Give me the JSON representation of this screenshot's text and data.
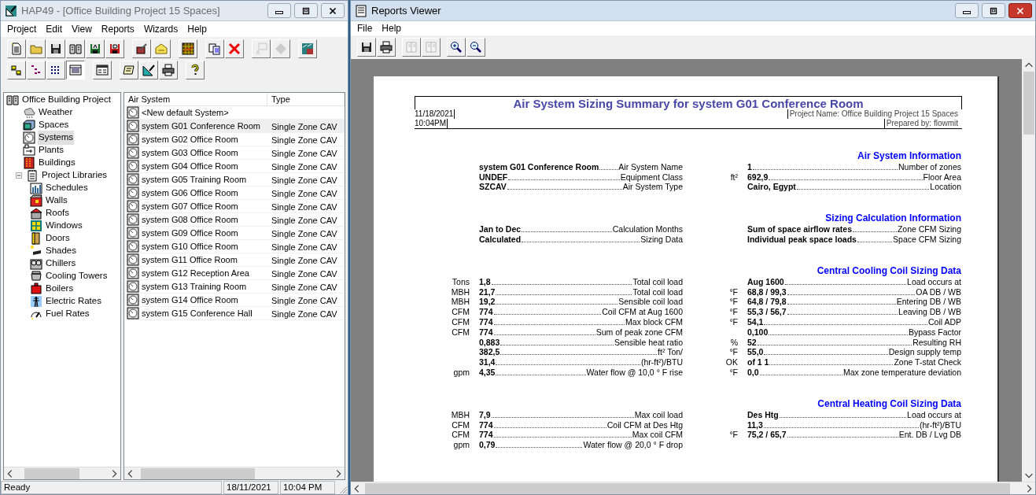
{
  "hap_window": {
    "title": "HAP49 - [Office Building Project 15 Spaces]",
    "active": false,
    "menu": [
      "Project",
      "Edit",
      "View",
      "Reports",
      "Wizards",
      "Help"
    ],
    "toolbar_rows": [
      [
        [
          {
            "disabled": false
          },
          {
            "disabled": false
          },
          {
            "disabled": false
          },
          {
            "disabled": false
          },
          {
            "disabled": false
          },
          {
            "disabled": false
          }
        ],
        [
          {
            "disabled": false
          },
          {
            "disabled": false
          }
        ],
        [
          {
            "disabled": false
          }
        ],
        [
          {
            "disabled": false
          },
          {
            "disabled": false
          }
        ],
        [
          {
            "disabled": true
          },
          {
            "disabled": true
          }
        ],
        [
          {
            "disabled": false
          }
        ]
      ],
      [
        [
          {
            "disabled": false,
            "selected": false
          },
          {
            "disabled": false,
            "selected": false
          },
          {
            "disabled": false,
            "selected": false
          },
          {
            "disabled": false,
            "selected": true
          }
        ],
        [
          {
            "disabled": false
          }
        ],
        [
          {
            "disabled": false
          },
          {
            "disabled": false
          },
          {
            "disabled": false
          }
        ],
        [
          {
            "disabled": false
          }
        ]
      ]
    ],
    "tree": [
      {
        "label": "Office Building Project",
        "selected": false,
        "children": [
          {
            "label": "Weather",
            "selected": false
          },
          {
            "label": "Spaces",
            "selected": false
          },
          {
            "label": "Systems",
            "selected": true
          },
          {
            "label": "Plants",
            "selected": false
          },
          {
            "label": "Buildings",
            "selected": false
          },
          {
            "label": "Project Libraries",
            "selected": false,
            "expanded": true,
            "children": [
              {
                "label": "Schedules",
                "selected": false
              },
              {
                "label": "Walls",
                "selected": false
              },
              {
                "label": "Roofs",
                "selected": false
              },
              {
                "label": "Windows",
                "selected": false
              },
              {
                "label": "Doors",
                "selected": false
              },
              {
                "label": "Shades",
                "selected": false
              },
              {
                "label": "Chillers",
                "selected": false
              },
              {
                "label": "Cooling Towers",
                "selected": false
              },
              {
                "label": "Boilers",
                "selected": false
              },
              {
                "label": "Electric Rates",
                "selected": false
              },
              {
                "label": "Fuel Rates",
                "selected": false
              }
            ]
          }
        ]
      }
    ],
    "list": {
      "columns": [
        "Air System",
        "Type"
      ],
      "rows": [
        {
          "name": "<New default System>",
          "selected": false
        },
        {
          "name": "system G01 Conference Room",
          "type": "Single Zone CAV",
          "selected": true
        },
        {
          "name": "system G02 Office Room",
          "type": "Single Zone CAV",
          "selected": false
        },
        {
          "name": "system G03 Office Room",
          "type": "Single Zone CAV",
          "selected": false
        },
        {
          "name": "system G04 Office Room",
          "type": "Single Zone CAV",
          "selected": false
        },
        {
          "name": "system G05 Training Room",
          "type": "Single Zone CAV",
          "selected": false
        },
        {
          "name": "system G06 Office Room",
          "type": "Single Zone CAV",
          "selected": false
        },
        {
          "name": "system G07 Office Room",
          "type": "Single Zone CAV",
          "selected": false
        },
        {
          "name": "system G08 Office Room",
          "type": "Single Zone CAV",
          "selected": false
        },
        {
          "name": "system G09 Office Room",
          "type": "Single Zone CAV",
          "selected": false
        },
        {
          "name": "system G10 Office Room",
          "type": "Single Zone CAV",
          "selected": false
        },
        {
          "name": "system G11 Office Room",
          "type": "Single Zone CAV",
          "selected": false
        },
        {
          "name": "system G12 Reception Area",
          "type": "Single Zone CAV",
          "selected": false
        },
        {
          "name": "system G13 Training Room",
          "type": "Single Zone CAV",
          "selected": false
        },
        {
          "name": "system G14 Office Room",
          "type": "Single Zone CAV",
          "selected": false
        },
        {
          "name": "system G15 Conference Hall",
          "type": "Single Zone CAV",
          "selected": false
        }
      ]
    },
    "status_bar": {
      "message": "Ready",
      "date": "18/11/2021",
      "time": "10:04 PM"
    }
  },
  "reports_viewer": {
    "title": "Reports Viewer",
    "active": true,
    "menu": [
      "File",
      "Help"
    ],
    "toolbar": [
      [
        {
          "disabled": false
        },
        {
          "disabled": false
        }
      ],
      [
        {
          "disabled": true
        },
        {
          "disabled": true
        }
      ],
      [
        {
          "disabled": false
        },
        {
          "disabled": false
        }
      ]
    ],
    "report": {
      "title": "Air System Sizing Summary for system G01 Conference Room",
      "date": "11/18/2021",
      "time": "10:04PM",
      "project_name": "Project Name: Office Building Project 15 Spaces",
      "prepared_by": "Prepared by: flowmit",
      "bands": [
        {
          "heading": "Air System Information",
          "left": [
            {
              "value": "system G01 Conference Room",
              "label": "Air System Name"
            },
            {
              "value": "UNDEF",
              "label": "Equipment Class"
            },
            {
              "value": "SZCAV",
              "label": "Air System Type"
            }
          ],
          "right": [
            {
              "value": "1",
              "label": "Number of zones"
            },
            {
              "unit": "ft²",
              "value": "692,9",
              "label": "Floor Area"
            },
            {
              "value": "Cairo, Egypt",
              "label": "Location"
            }
          ]
        },
        {
          "heading": "Sizing Calculation Information",
          "left": [
            {
              "value": "Jan to Dec",
              "label": "Calculation Months"
            },
            {
              "value": "Calculated",
              "label": "Sizing Data"
            }
          ],
          "right": [
            {
              "value": "Sum of space airflow rates",
              "label": "Zone CFM Sizing"
            },
            {
              "value": "Individual peak space loads",
              "label": "Space CFM Sizing"
            }
          ]
        },
        {
          "heading": "Central Cooling Coil Sizing Data",
          "left": [
            {
              "unit": "Tons",
              "value": "1,8",
              "label": "Total coil load"
            },
            {
              "unit": "MBH",
              "value": "21,7",
              "label": "Total coil load"
            },
            {
              "unit": "MBH",
              "value": "19,2",
              "label": "Sensible coil load"
            },
            {
              "unit": "CFM",
              "value": "774",
              "label": "Coil CFM at Aug 1600"
            },
            {
              "unit": "CFM",
              "value": "774",
              "label": "Max block CFM"
            },
            {
              "unit": "CFM",
              "value": "774",
              "label": "Sum of peak zone CFM"
            },
            {
              "value": "0,883",
              "label": "Sensible heat ratio"
            },
            {
              "value": "382,5",
              "label": "ft² Ton/"
            },
            {
              "value": "31,4",
              "label": "(hr-ft²)/BTU"
            },
            {
              "unit": "gpm",
              "value": "4,35",
              "label": "Water flow @ 10,0 ° F rise"
            }
          ],
          "right": [
            {
              "value": "Aug 1600",
              "label": "Load occurs at"
            },
            {
              "unit": "°F",
              "value": "68,8 / 99,3",
              "label": "OA DB / WB"
            },
            {
              "unit": "°F",
              "value": "64,8 / 79,8",
              "label": "Entering DB / WB"
            },
            {
              "unit": "°F",
              "value": "55,3 / 56,7",
              "label": "Leaving DB / WB"
            },
            {
              "unit": "°F",
              "value": "54,1",
              "label": "Coil ADP"
            },
            {
              "value": "0,100",
              "label": "Bypass Factor"
            },
            {
              "unit": "%",
              "value": "52",
              "label": "Resulting RH"
            },
            {
              "unit": "°F",
              "value": "55,0",
              "label": "Design supply temp"
            },
            {
              "unit": "OK",
              "value": "of 1 1",
              "label": "Zone T-stat Check"
            },
            {
              "unit": "°F",
              "value": "0,0",
              "label": "Max zone temperature deviation"
            }
          ]
        },
        {
          "heading": "Central Heating Coil Sizing Data",
          "left": [
            {
              "unit": "MBH",
              "value": "7,9",
              "label": "Max coil load"
            },
            {
              "unit": "CFM",
              "value": "774",
              "label": "Coil CFM at Des Htg"
            },
            {
              "unit": "CFM",
              "value": "774",
              "label": "Max coil CFM"
            },
            {
              "unit": "gpm",
              "value": "0,79",
              "label": "Water flow @ 20,0 ° F drop"
            }
          ],
          "right": [
            {
              "value": "Des Htg",
              "label": "Load occurs at"
            },
            {
              "value": "11,3",
              "label": "(hr-ft²)/BTU"
            },
            {
              "unit": "°F",
              "value": "75,2 / 65,7",
              "label": "Ent. DB / Lvg DB"
            }
          ]
        }
      ]
    }
  }
}
